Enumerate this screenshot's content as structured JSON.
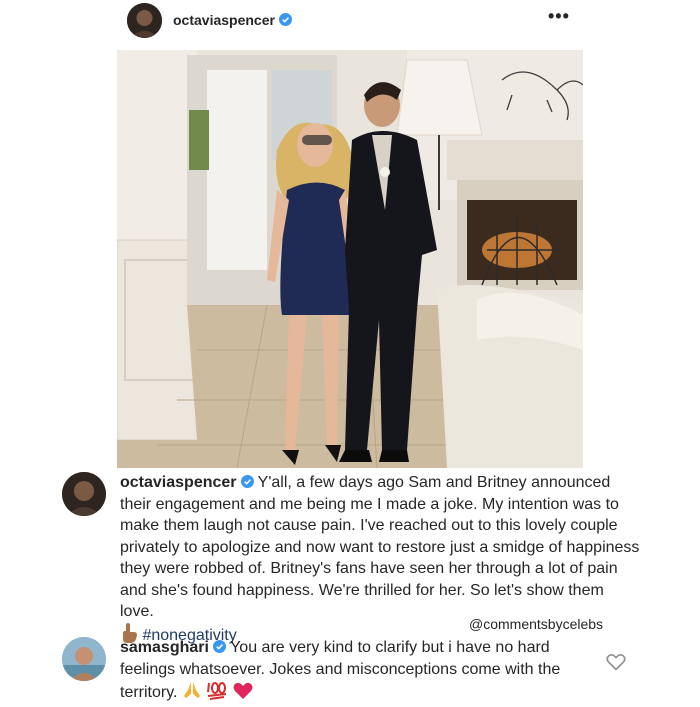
{
  "post": {
    "username": "octaviaspencer",
    "more_icon": "•••"
  },
  "comments": [
    {
      "username": "octaviaspencer",
      "text": "Y'all, a few days ago Sam and Britney announced their engagement and me being me I made a joke. My intention was to make them laugh not cause pain. I've reached out to this lovely couple privately to apologize and now want to restore just a smidge of happiness they were robbed of. Britney's fans have seen her through a lot of pain and she's found happiness. We're thrilled for her. So let's show them love.",
      "hashtag": "#nonegativity"
    },
    {
      "username": "samasghari",
      "text": "You are very kind to clarify but i have no hard feelings whatsoever. Jokes and misconceptions come with the territory."
    }
  ],
  "credit": "@commentsbycelebs",
  "colors": {
    "verified": "#3897f0",
    "hashtag": "#1f3b63",
    "heart": "#e0245e"
  }
}
